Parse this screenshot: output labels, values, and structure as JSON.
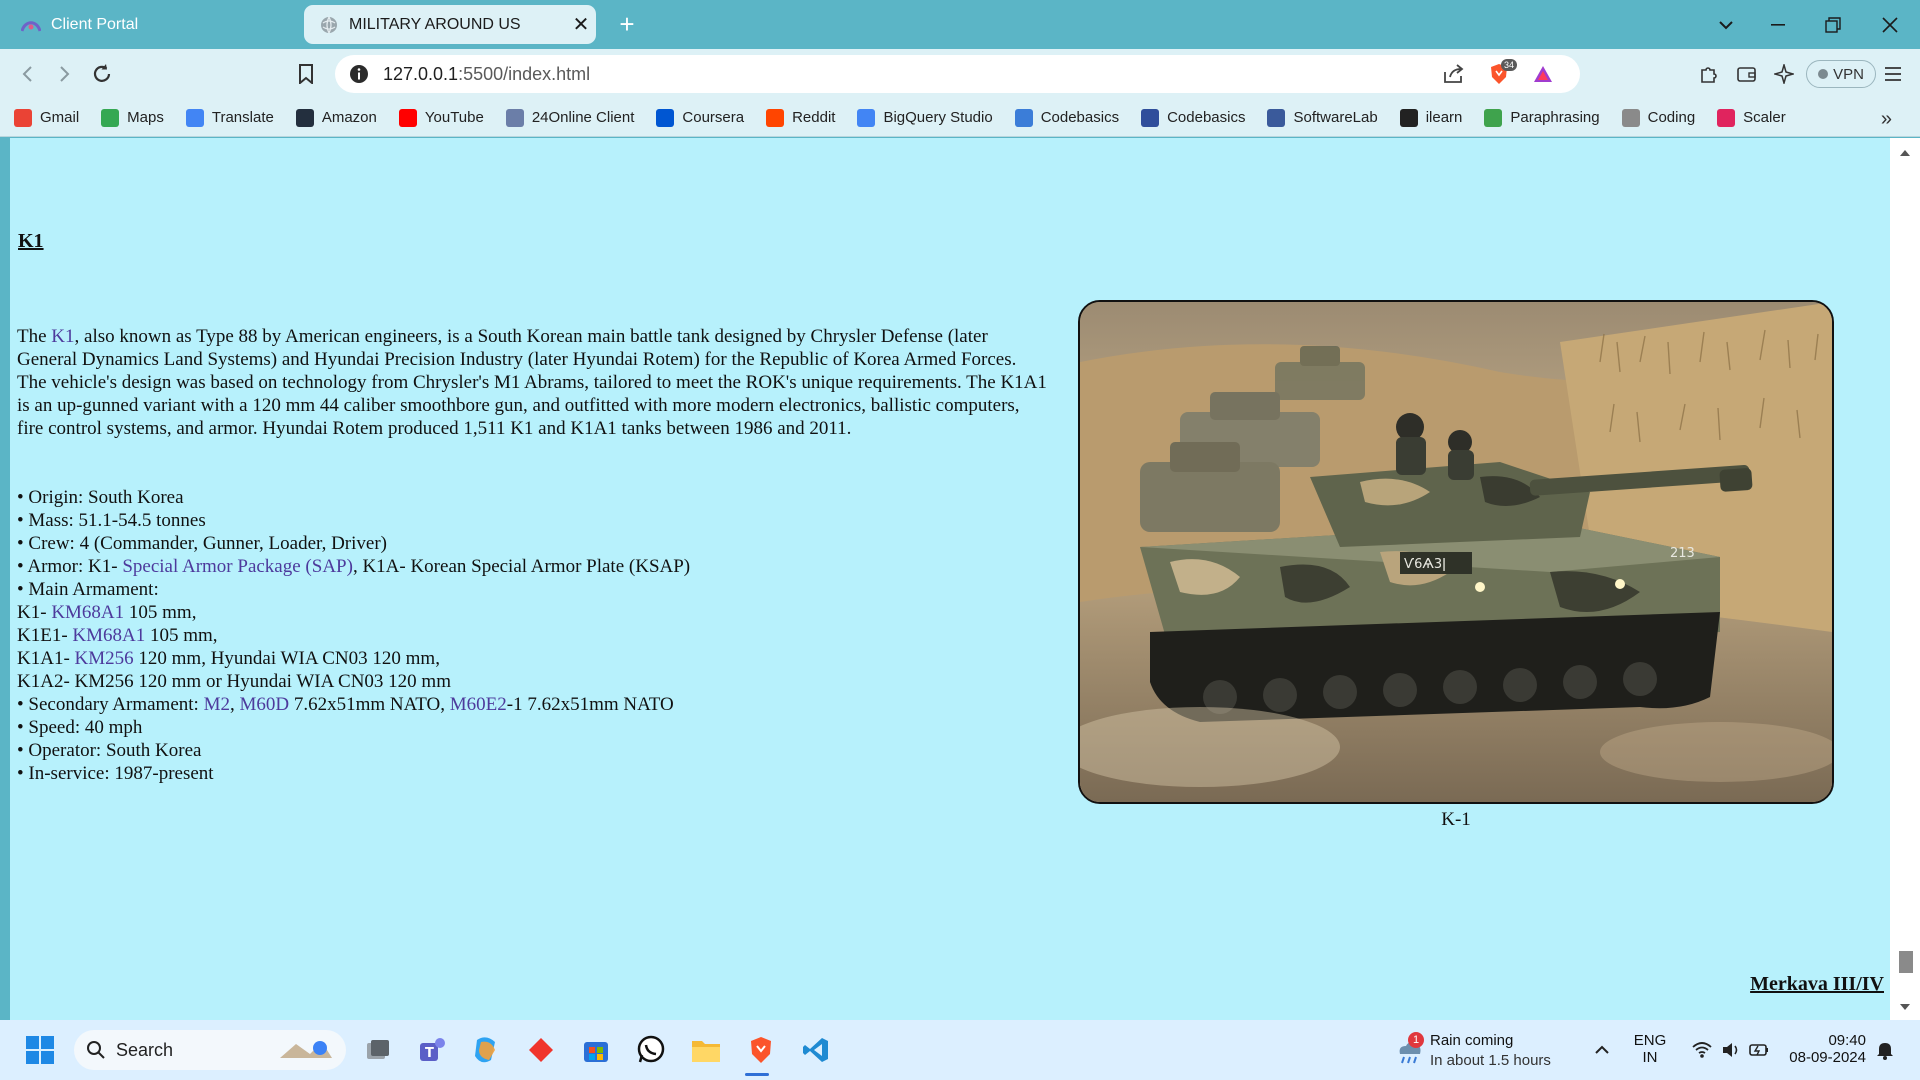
{
  "browser": {
    "tabs": [
      {
        "title": "Client Portal",
        "active": false
      },
      {
        "title": "MILITARY AROUND US",
        "active": true
      }
    ],
    "url_host": "127.0.0.1",
    "url_path": ":5500/index.html",
    "shields_count": "34",
    "vpn_label": "VPN",
    "bookmarks": [
      {
        "label": "Gmail",
        "icon": "gmail-icon",
        "color": "#ea4335"
      },
      {
        "label": "Maps",
        "icon": "maps-icon",
        "color": "#34a853"
      },
      {
        "label": "Translate",
        "icon": "translate-icon",
        "color": "#4285f4"
      },
      {
        "label": "Amazon",
        "icon": "amazon-icon",
        "color": "#232f3e"
      },
      {
        "label": "YouTube",
        "icon": "youtube-icon",
        "color": "#ff0000"
      },
      {
        "label": "24Online Client",
        "icon": "24online-icon",
        "color": "#6b7ea8"
      },
      {
        "label": "Coursera",
        "icon": "coursera-icon",
        "color": "#0056d2"
      },
      {
        "label": "Reddit",
        "icon": "reddit-icon",
        "color": "#ff4500"
      },
      {
        "label": "BigQuery Studio",
        "icon": "bigquery-icon",
        "color": "#4285f4"
      },
      {
        "label": "Codebasics",
        "icon": "codebasics-rocket-icon",
        "color": "#3b7dd8"
      },
      {
        "label": "Codebasics",
        "icon": "codebasics-c-icon",
        "color": "#2f4e9b"
      },
      {
        "label": "SoftwareLab",
        "icon": "softwarelab-icon",
        "color": "#3a5a9b"
      },
      {
        "label": "ilearn",
        "icon": "ilearn-icon",
        "color": "#222222"
      },
      {
        "label": "Paraphrasing",
        "icon": "paraphrasing-icon",
        "color": "#3fa34d"
      },
      {
        "label": "Coding",
        "icon": "coding-icon",
        "color": "#8a8a8a"
      },
      {
        "label": "Scaler",
        "icon": "scaler-icon",
        "color": "#e0245e"
      }
    ]
  },
  "page": {
    "k1_heading": "K1",
    "desc_intro": "The ",
    "desc_link": "K1",
    "desc_rest": ", also known as Type 88 by American engineers, is a South Korean main battle tank designed by Chrysler Defense (later General Dynamics Land Systems) and Hyundai Precision Industry (later Hyundai Rotem) for the Republic of Korea Armed Forces. The vehicle's design was based on technology from Chrysler's M1 Abrams, tailored to meet the ROK's unique requirements. The K1A1 is an up-gunned variant with a 120 mm 44 caliber smoothbore gun, and outfitted with more modern electronics, ballistic computers, fire control systems, and armor. Hyundai Rotem produced 1,511 K1 and K1A1 tanks between 1986 and 2011.",
    "specs": {
      "origin": "• Origin: South Korea",
      "mass": "• Mass: 51.1-54.5 tonnes",
      "crew": "• Crew: 4 (Commander, Gunner, Loader, Driver)",
      "armor_pre": "• Armor: K1- ",
      "armor_link": "Special Armor Package (SAP)",
      "armor_post": ", K1A- Korean Special Armor Plate (KSAP)",
      "main_armament": "• Main Armament:",
      "k1_pre": "K1- ",
      "k1_link": "KM68A1",
      "k1_post": " 105 mm,",
      "k1e1_pre": "K1E1- ",
      "k1e1_link": "KM68A1",
      "k1e1_post": " 105 mm,",
      "k1a1_pre": "K1A1- ",
      "k1a1_link": "KM256",
      "k1a1_post": " 120 mm, Hyundai WIA CN03 120 mm,",
      "k1a2": "K1A2- KM256 120 mm or Hyundai WIA CN03 120 mm",
      "secondary_pre": "• Secondary Armament: ",
      "secondary_link1": "M2",
      "secondary_sep": ", ",
      "secondary_link2": "M60D",
      "secondary_mid": " 7.62x51mm NATO, ",
      "secondary_link3": "M60E2",
      "secondary_post": "-1 7.62x51mm NATO",
      "speed": "• Speed: 40 mph",
      "operator": "• Operator: South Korea",
      "in_service": "• In-service: 1987-present"
    },
    "image_caption": "K-1",
    "tank_markings": {
      "hull_number": "Ѵ6Ѧ3ǀ",
      "turret_number": "213"
    },
    "next_heading": "Merkava III/IV"
  },
  "taskbar": {
    "search_label": "Search",
    "weather_badge": "1",
    "weather_title": "Rain coming",
    "weather_sub": "In about 1.5 hours",
    "lang_top": "ENG",
    "lang_bottom": "IN",
    "time": "09:40",
    "date": "08-09-2024"
  },
  "colors": {
    "page_background": "#b7f1fc",
    "link": "#4d3a9c",
    "chrome_frame": "#5bb5c6",
    "chrome_toolbar": "#ddf1f6"
  }
}
